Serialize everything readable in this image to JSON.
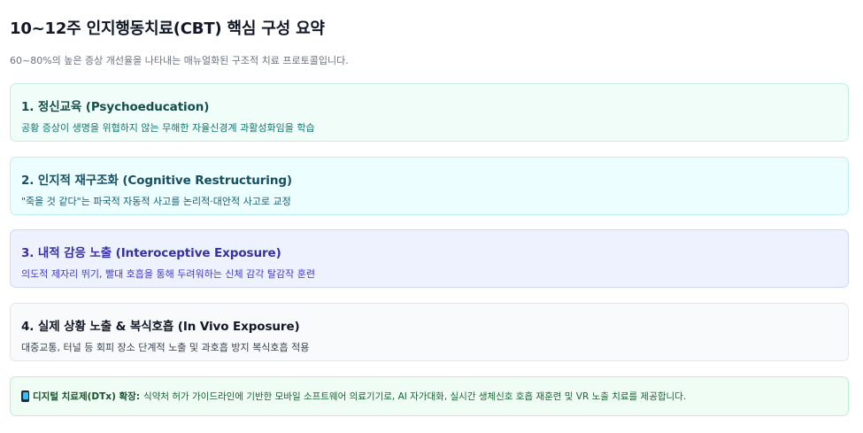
{
  "header": {
    "title": "10~12주 인지행동치료(CBT) 핵심 구성 요약",
    "subtitle": "60~80%의 높은 증상 개선율을 나타내는 매뉴얼화된 구조적 치료 프로토콜입니다."
  },
  "cards": [
    {
      "title": "1. 정신교육 (Psychoeducation)",
      "desc": "공황 증상이 생명을 위협하지 않는 무해한 자율신경계 과활성화임을 학습"
    },
    {
      "title": "2. 인지적 재구조화 (Cognitive Restructuring)",
      "desc": "\"죽을 것 같다\"는 파국적 자동적 사고를 논리적·대안적 사고로 교정"
    },
    {
      "title": "3. 내적 감응 노출 (Interoceptive Exposure)",
      "desc": "의도적 제자리 뛰기, 빨대 호흡을 통해 두려워하는 신체 감각 탈감작 훈련"
    },
    {
      "title": "4. 실제 상황 노출 & 복식호흡 (In Vivo Exposure)",
      "desc": "대중교통, 터널 등 회피 장소 단계적 노출 및 과호흡 방지 복식호흡 적용"
    }
  ],
  "note": {
    "icon": "mobile-phone-icon",
    "label": "디지털 치료제(DTx) 확장:",
    "text": "식약처 허가 가이드라인에 기반한 모바일 소프트웨어 의료기기로, AI 자가대화, 실시간 생체신호 호흡 재훈련 및 VR 노출 치료를 제공합니다."
  }
}
